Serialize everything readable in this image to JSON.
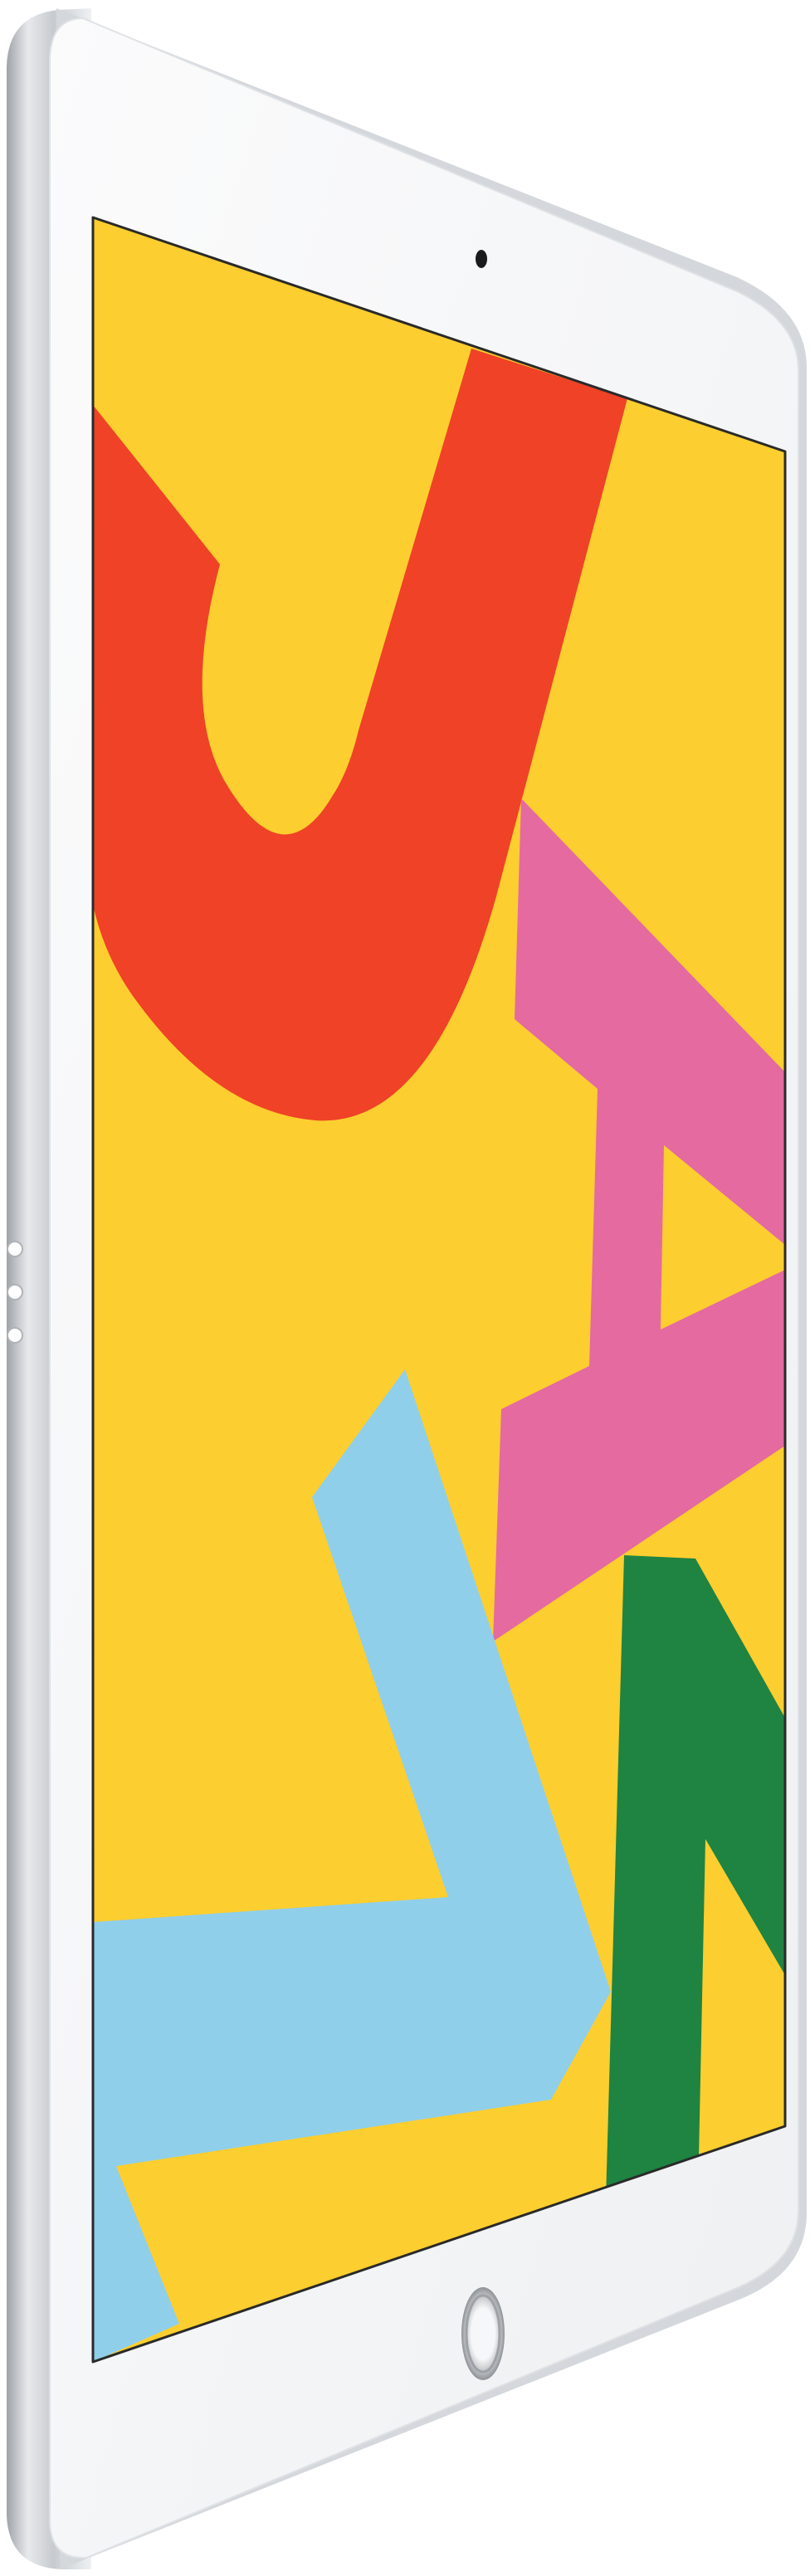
{
  "scene": {
    "subject": "tablet",
    "device_color": "silver",
    "palette": {
      "background": "#ffffff",
      "body_shadow": "#b9bdc2",
      "body_edge": "#d6d9dd",
      "bezel": "#f4f5f7",
      "screen_outline": "#2a2a2a",
      "wallpaper_yellow": "#fdce2f",
      "shape_red": "#ef4226",
      "shape_pink": "#e46aa0",
      "shape_blue": "#8fcfea",
      "shape_green": "#1f8341",
      "camera": "#1b1b1d",
      "home_button_ring": "#b5b8bc"
    },
    "icons": [
      "front-camera-icon",
      "home-button-icon",
      "smart-connector-icon"
    ]
  }
}
